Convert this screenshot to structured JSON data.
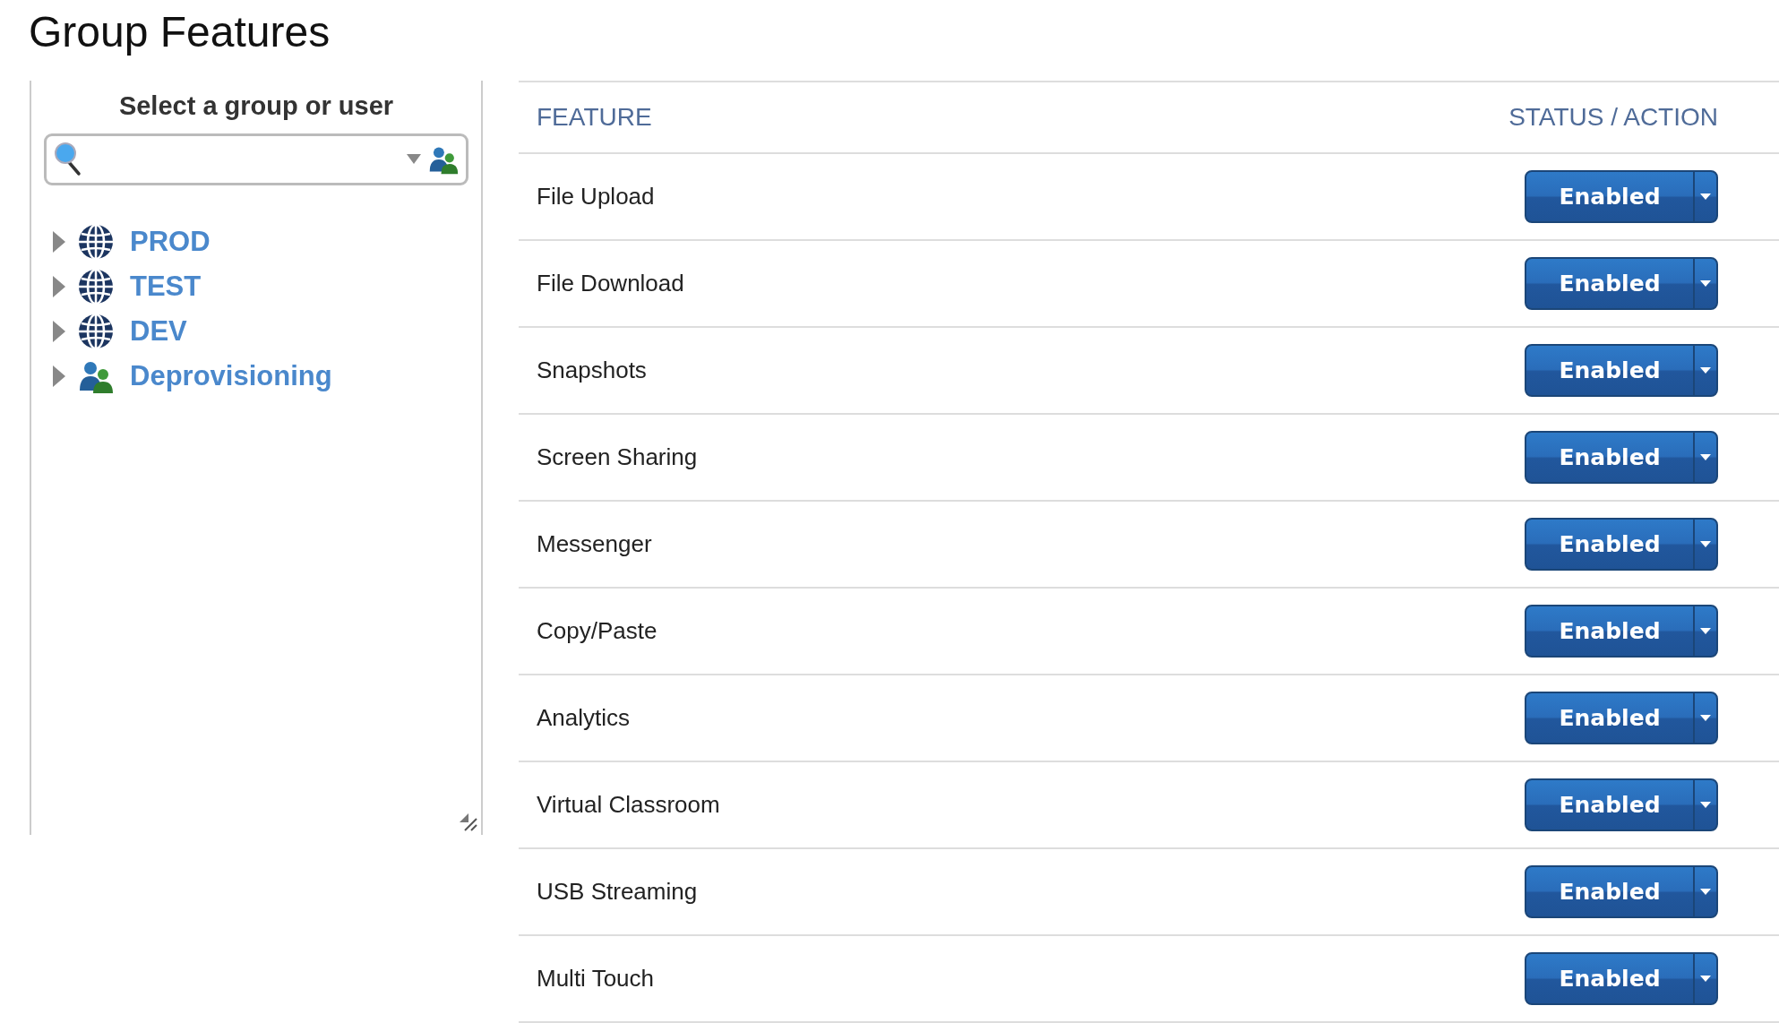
{
  "title": "Group Features",
  "sidebar": {
    "heading": "Select a group or user",
    "tree": [
      {
        "label": "PROD",
        "kind": "globe",
        "expanded": false
      },
      {
        "label": "TEST",
        "kind": "globe",
        "expanded": false
      },
      {
        "label": "DEV",
        "kind": "globe",
        "expanded": false
      },
      {
        "label": "Deprovisioning",
        "kind": "users",
        "expanded": false
      }
    ]
  },
  "table": {
    "columns": [
      "FEATURE",
      "STATUS / ACTION"
    ],
    "rows": [
      {
        "feature": "File Upload",
        "status": "Enabled"
      },
      {
        "feature": "File Download",
        "status": "Enabled"
      },
      {
        "feature": "Snapshots",
        "status": "Enabled"
      },
      {
        "feature": "Screen Sharing",
        "status": "Enabled"
      },
      {
        "feature": "Messenger",
        "status": "Enabled"
      },
      {
        "feature": "Copy/Paste",
        "status": "Enabled"
      },
      {
        "feature": "Analytics",
        "status": "Enabled"
      },
      {
        "feature": "Virtual Classroom",
        "status": "Enabled"
      },
      {
        "feature": "USB Streaming",
        "status": "Enabled"
      },
      {
        "feature": "Multi Touch",
        "status": "Enabled"
      }
    ]
  }
}
